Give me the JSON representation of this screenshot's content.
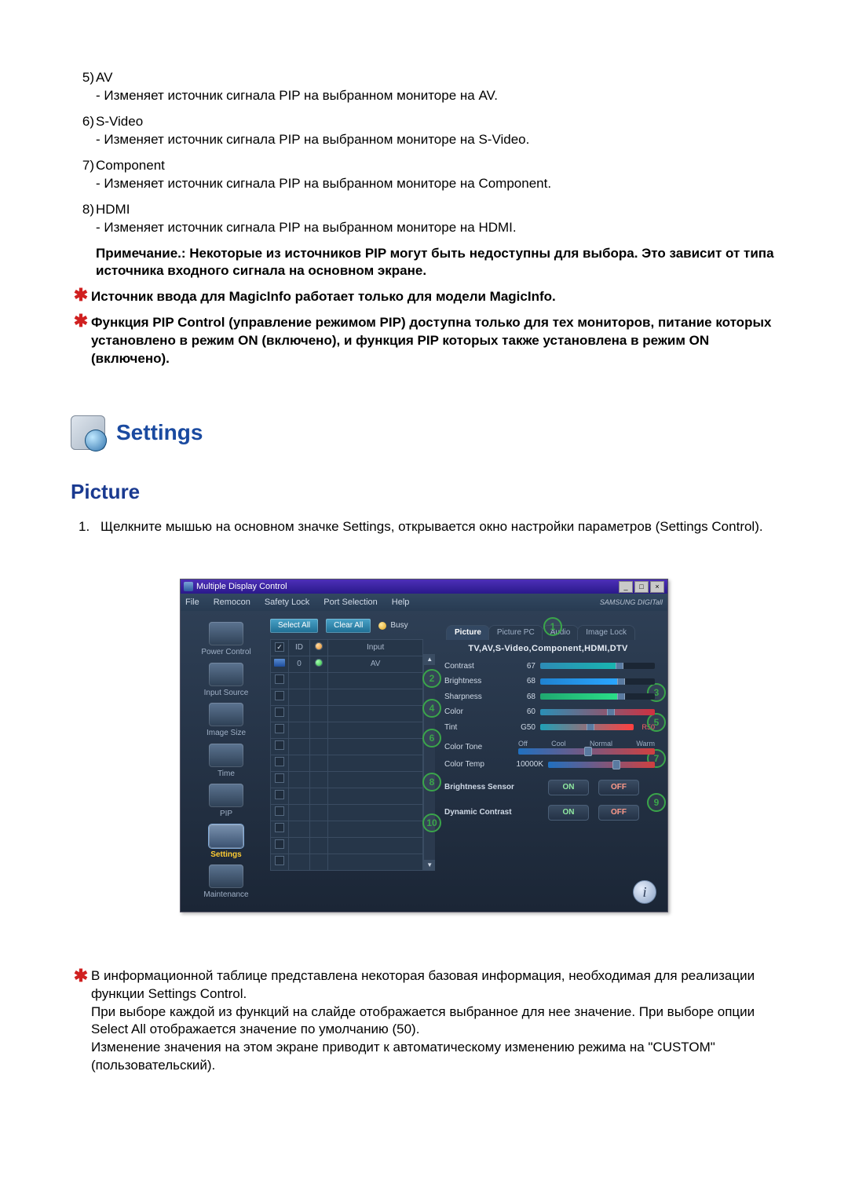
{
  "list": {
    "items": [
      {
        "num": "5)",
        "title": "AV",
        "sub": "- Изменяет источник сигнала PIP на выбранном мониторе на AV."
      },
      {
        "num": "6)",
        "title": "S-Video",
        "sub": "- Изменяет источник сигнала PIP на выбранном мониторе на S-Video."
      },
      {
        "num": "7)",
        "title": "Component",
        "sub": "- Изменяет источник сигнала PIP на выбранном мониторе на Component."
      },
      {
        "num": "8)",
        "title": "HDMI",
        "sub": "- Изменяет источник сигнала PIP на выбранном мониторе на HDMI."
      }
    ],
    "note_bold": "Примечание.: Некоторые из источников PIP могут быть недоступны для выбора. Это зависит от типа источника входного сигнала на основном экране."
  },
  "stars": {
    "s1": "Источник ввода для MagicInfo работает только для модели MagicInfo.",
    "s2": "Функция PIP Control (управление режимом PIP) доступна только для тех мониторов, питание которых установлено в режим ON (включено), и функция PIP которых также установлена в режим ON (включено)."
  },
  "settings_title": "Settings",
  "picture_title": "Picture",
  "step1": {
    "num": "1.",
    "text": "Щелкните мышью на основном значке Settings, открывается окно настройки параметров (Settings Control)."
  },
  "shot": {
    "title": "Multiple Display Control",
    "menus": [
      "File",
      "Remocon",
      "Safety Lock",
      "Port Selection",
      "Help"
    ],
    "brand": "SAMSUNG DIGITall",
    "buttons": {
      "select": "Select All",
      "clear": "Clear All",
      "busy": "Busy"
    },
    "grid": {
      "headers": {
        "id": "ID",
        "input": "Input"
      },
      "row0": {
        "id": "0",
        "input": "AV"
      }
    },
    "sidebar": [
      "Power Control",
      "Input Source",
      "Image Size",
      "Time",
      "PIP",
      "Settings",
      "Maintenance"
    ],
    "tabs": [
      "Picture",
      "Picture PC",
      "Audio",
      "Image Lock"
    ],
    "tvline": "TV,AV,S-Video,Component,HDMI,DTV",
    "rows": {
      "contrast": {
        "label": "Contrast",
        "val": "67"
      },
      "brightness": {
        "label": "Brightness",
        "val": "68"
      },
      "sharpness": {
        "label": "Sharpness",
        "val": "68"
      },
      "color": {
        "label": "Color",
        "val": "60"
      },
      "tint": {
        "label": "Tint",
        "val": "G50",
        "end": "R50"
      },
      "colortone": {
        "label": "Color Tone",
        "opts": [
          "Off",
          "Cool",
          "Normal",
          "Warm"
        ]
      },
      "colortemp": {
        "label": "Color Temp",
        "val": "10000K"
      },
      "brightsensor": {
        "label": "Brightness Sensor",
        "on": "ON",
        "off": "OFF"
      },
      "dyncontrast": {
        "label": "Dynamic Contrast",
        "on": "ON",
        "off": "OFF"
      }
    },
    "callouts": {
      "c1": "1",
      "c2": "2",
      "c3": "3",
      "c4": "4",
      "c5": "5",
      "c6": "6",
      "c7": "7",
      "c8": "8",
      "c9": "9",
      "c10": "10"
    }
  },
  "footnote": {
    "p1": "В информационной таблице представлена некоторая базовая информация, необходимая для реализации функции Settings Control.",
    "p2": "При выборе каждой из функций на слайде отображается выбранное для нее значение. При выборе опции Select All отображается значение по умолчанию (50).",
    "p3": "Изменение значения на этом экране приводит к автоматическому изменению режима на \"CUSTOM\" (пользовательский)."
  },
  "asterisk": "✱"
}
